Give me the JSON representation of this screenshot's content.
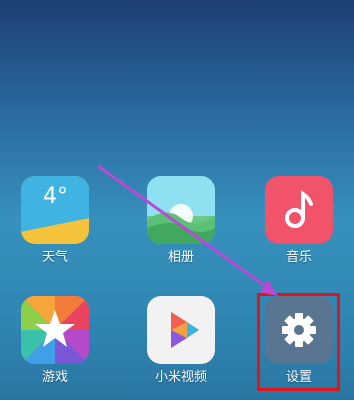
{
  "apps": [
    {
      "label": "天气",
      "icon": "weather-icon",
      "temperature": "4°"
    },
    {
      "label": "相册",
      "icon": "gallery-icon"
    },
    {
      "label": "音乐",
      "icon": "music-icon"
    },
    {
      "label": "游戏",
      "icon": "star-icon"
    },
    {
      "label": "小米视频",
      "icon": "play-icon"
    },
    {
      "label": "设置",
      "icon": "gear-icon"
    }
  ],
  "colors": {
    "highlight": "#e0141a",
    "arrow": "#b84bd6"
  }
}
